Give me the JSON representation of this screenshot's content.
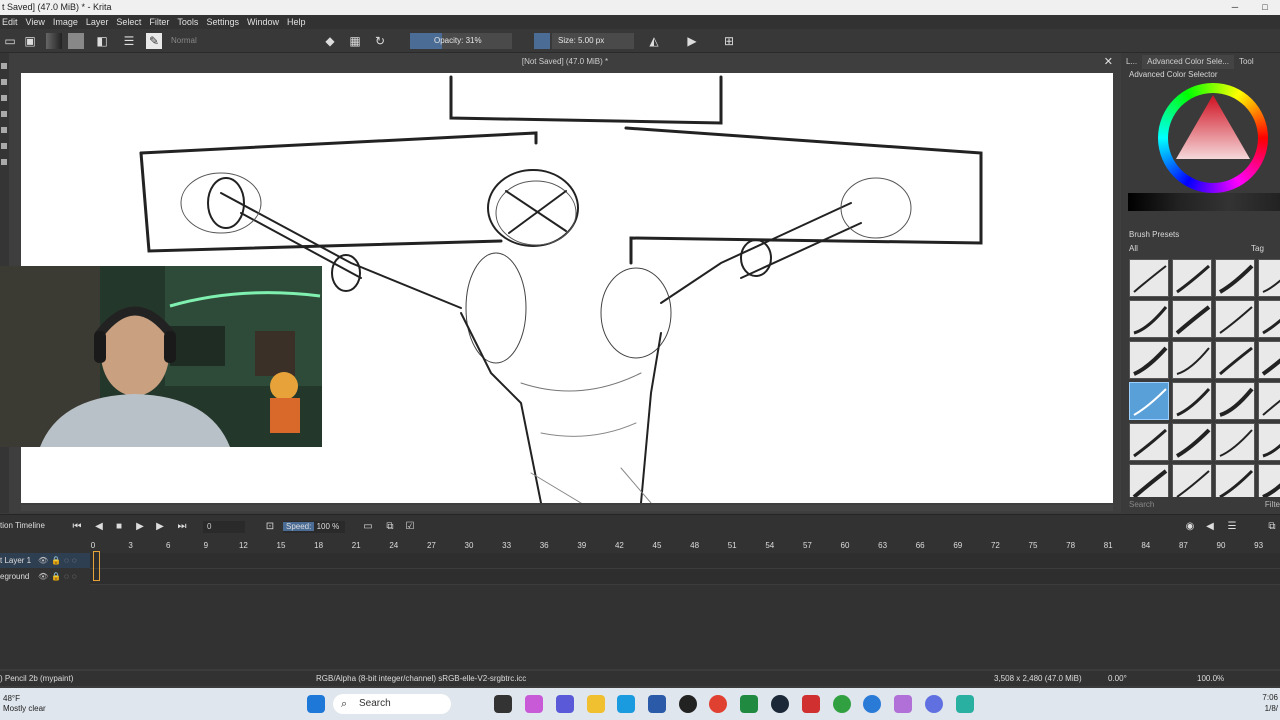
{
  "window": {
    "title": "t Saved]  (47.0 MiB) * - Krita",
    "controls": [
      "─",
      "□"
    ]
  },
  "menu": [
    "Edit",
    "View",
    "Image",
    "Layer",
    "Select",
    "Filter",
    "Tools",
    "Settings",
    "Window",
    "Help"
  ],
  "toolbar": {
    "blend_mode": "Normal",
    "opacity_label": "Opacity: 31%",
    "opacity_value": 0.31,
    "size_label": "Size: 5.00 px"
  },
  "document": {
    "title": "[Not Saved]  (47.0 MiB) *",
    "close": "✕"
  },
  "dock": {
    "tabs": [
      "L...",
      "Advanced Color Sele...",
      "Tool"
    ],
    "color_selector_title": "Advanced Color Selector",
    "brush_presets_title": "Brush Presets",
    "filter_all": "All",
    "tag_label": "Tag",
    "search_placeholder": "Search",
    "filter_label": "Filte"
  },
  "timeline": {
    "title": "tion Timeline",
    "frame": "0",
    "speed_label": "Speed:",
    "speed_value": "100 %",
    "ruler": [
      "0",
      "3",
      "6",
      "9",
      "12",
      "15",
      "18",
      "21",
      "24",
      "27",
      "30",
      "33",
      "36",
      "39",
      "42",
      "45",
      "48",
      "51",
      "54",
      "57",
      "60",
      "63",
      "66",
      "69",
      "72",
      "75",
      "78",
      "81",
      "84",
      "87",
      "90",
      "93"
    ],
    "layers": [
      {
        "name": "t Layer 1"
      },
      {
        "name": "eground"
      }
    ]
  },
  "status": {
    "brush": ") Pencil 2b (mypaint)",
    "colorspace": "RGB/Alpha (8-bit integer/channel)  sRGB-elle-V2-srgbtrc.icc",
    "dimensions": "3,508 x 2,480 (47.0 MiB)",
    "rotation": "0.00°",
    "zoom": "100.0%"
  },
  "taskbar": {
    "temperature": "48°F",
    "weather": "Mostly clear",
    "search": "Search",
    "time": "7:06",
    "date": "1/8/"
  }
}
